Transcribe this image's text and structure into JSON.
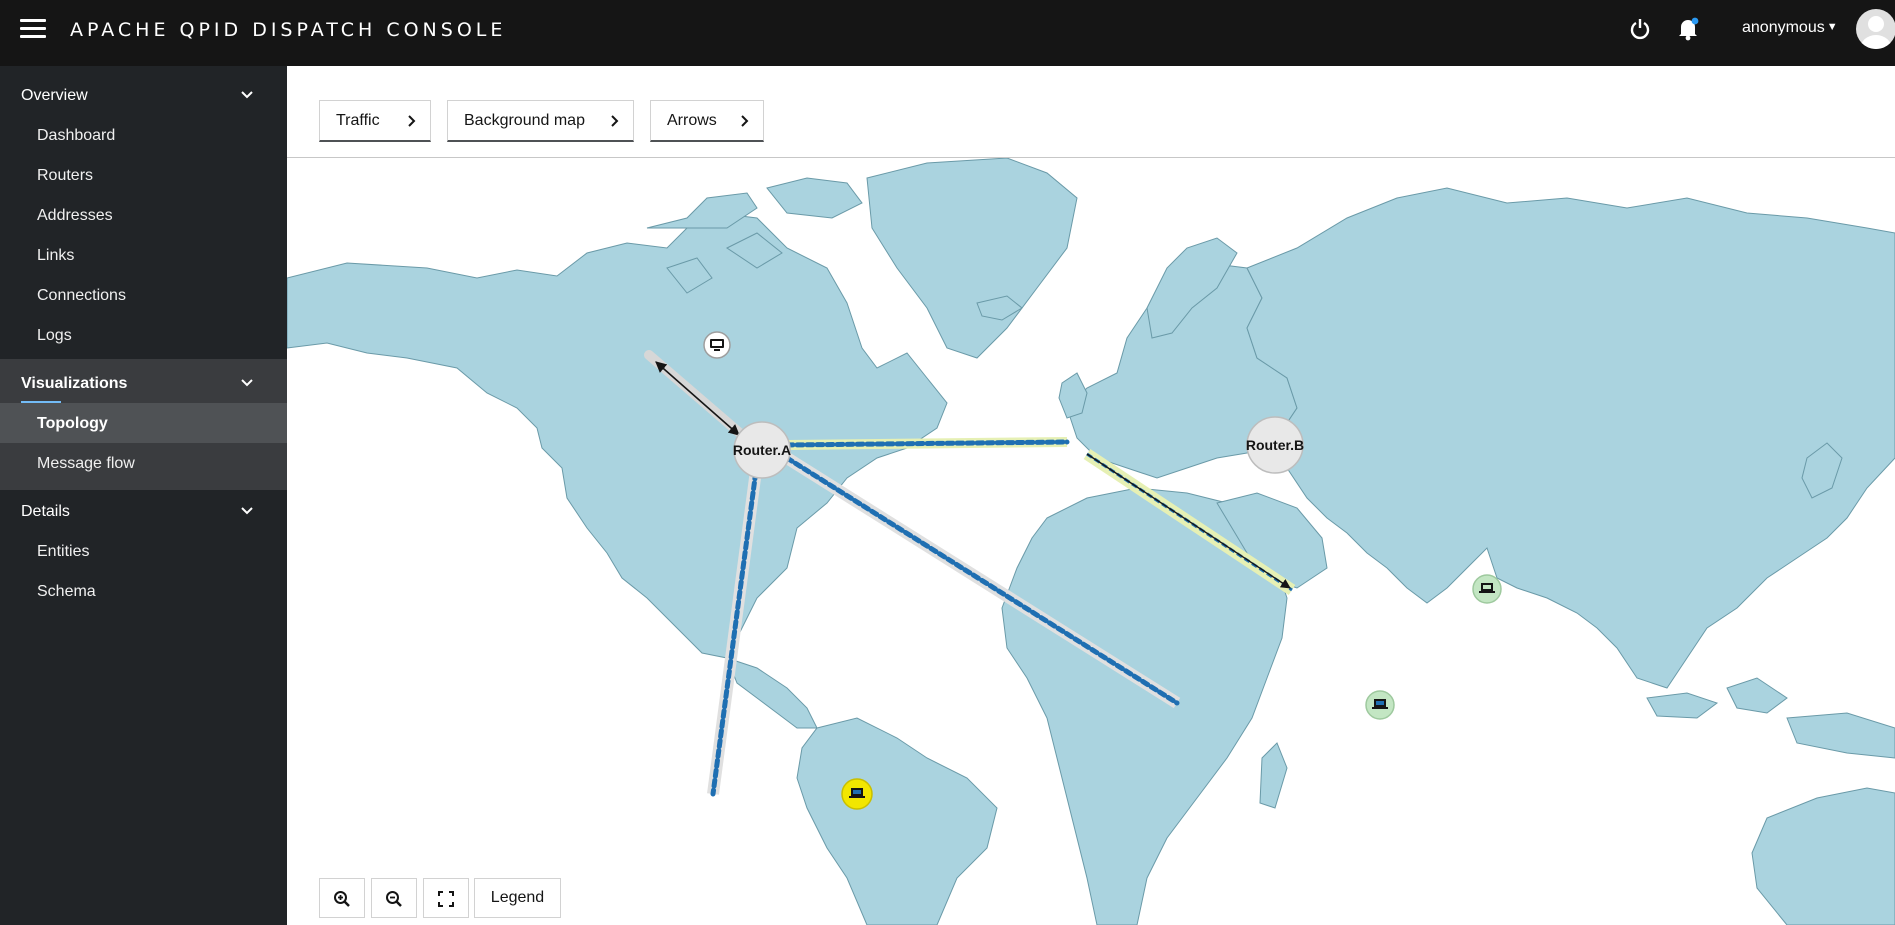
{
  "app": {
    "title": "APACHE QPID DISPATCH CONSOLE",
    "user": "anonymous"
  },
  "sidebar": {
    "overview": {
      "label": "Overview",
      "items": [
        "Dashboard",
        "Routers",
        "Addresses",
        "Links",
        "Connections",
        "Logs"
      ]
    },
    "visualizations": {
      "label": "Visualizations",
      "items": [
        "Topology",
        "Message flow"
      ],
      "active": "Topology"
    },
    "details": {
      "label": "Details",
      "items": [
        "Entities",
        "Schema"
      ]
    }
  },
  "toolbar": {
    "traffic": "Traffic",
    "background_map": "Background map",
    "arrows": "Arrows"
  },
  "topology": {
    "routers": [
      "Router.A",
      "Router.B"
    ]
  },
  "map_controls": {
    "legend": "Legend"
  },
  "colors": {
    "masthead": "#151515",
    "sidebar": "#212427",
    "land": "#aad3df",
    "flow": "#1f6fb2",
    "router_fill": "#e8e8e8",
    "client_green": "#c3e6c3",
    "client_yellow": "#f2e600"
  }
}
